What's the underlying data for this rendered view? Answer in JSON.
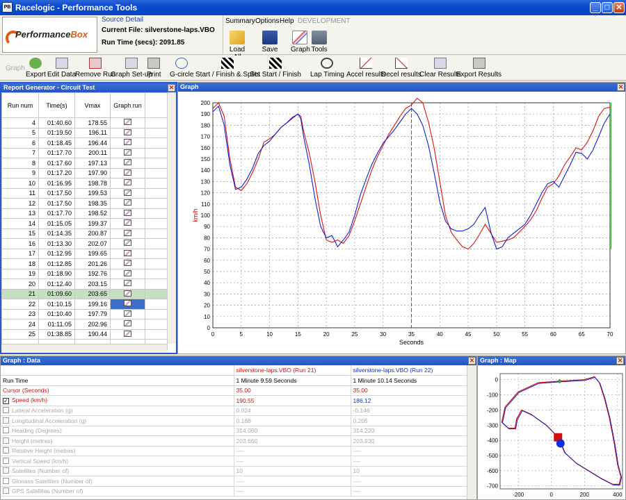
{
  "window": {
    "title": "Racelogic - Performance Tools",
    "min": "_",
    "max": "□",
    "close": "✕",
    "icon_text": "PB"
  },
  "logo": {
    "text_a": "Performance",
    "text_b": "Box"
  },
  "source": {
    "heading": "Source Detail",
    "file_label": "Current File:",
    "file": "silverstone-laps.VBO",
    "runtime_label": "Run Time (secs):",
    "runtime": "2091.85"
  },
  "menu": {
    "summary": "Summary",
    "options": "Options",
    "help": "Help",
    "development": "DEVELOPMENT"
  },
  "top_icons": {
    "load_all": "Load All",
    "save": "Save",
    "graph": "Graph",
    "tools": "Tools"
  },
  "toolbar": {
    "group_label": "Graph",
    "items": [
      "Export",
      "Edit Data",
      "Remove Run",
      "Graph Set-up",
      "Print",
      "G-circle",
      "Start / Finish & Splits",
      "Set Start / Finish",
      "Lap Timing",
      "Accel results",
      "Decel results",
      "Clear Results",
      "Export Results"
    ]
  },
  "report": {
    "title": "Report Generator - Circuit Test",
    "columns": [
      "Run num",
      "Time(s)",
      "Vmax",
      "Graph run"
    ],
    "rows": [
      [
        "4",
        "01:40.60",
        "178.55"
      ],
      [
        "5",
        "01:19.50",
        "196.11"
      ],
      [
        "6",
        "01:18.45",
        "196.44"
      ],
      [
        "7",
        "01:17.70",
        "200.11"
      ],
      [
        "8",
        "01:17.60",
        "197.13"
      ],
      [
        "9",
        "01:17.20",
        "197.90"
      ],
      [
        "10",
        "01:16.95",
        "198.78"
      ],
      [
        "11",
        "01:17.50",
        "199.53"
      ],
      [
        "12",
        "01:17.50",
        "198.35"
      ],
      [
        "13",
        "01:17.70",
        "198.52"
      ],
      [
        "14",
        "01:15.05",
        "199.37"
      ],
      [
        "15",
        "01:14.35",
        "200.87"
      ],
      [
        "16",
        "01:13.30",
        "202.07"
      ],
      [
        "17",
        "01:12.95",
        "199.65"
      ],
      [
        "18",
        "01:12.85",
        "201.26"
      ],
      [
        "19",
        "01:18.90",
        "192.76"
      ],
      [
        "20",
        "01:12.40",
        "203.15"
      ],
      [
        "21",
        "01:09.60",
        "203.65"
      ],
      [
        "22",
        "01:10.15",
        "199.16"
      ],
      [
        "23",
        "01:10.40",
        "197.79"
      ],
      [
        "24",
        "01:11.05",
        "202.96"
      ],
      [
        "25",
        "01:38.85",
        "190.44"
      ]
    ],
    "selected_run": "21"
  },
  "graph_panel": {
    "title": "Graph"
  },
  "chart_data": {
    "type": "line",
    "title": "",
    "xlabel": "Seconds",
    "ylabel": "km/h",
    "xlim": [
      0,
      70
    ],
    "ylim": [
      0,
      200
    ],
    "xticks": [
      0,
      5,
      10,
      15,
      20,
      25,
      30,
      35,
      40,
      45,
      50,
      55,
      60,
      65,
      70
    ],
    "yticks": [
      0,
      10,
      20,
      30,
      40,
      50,
      60,
      70,
      80,
      90,
      100,
      110,
      120,
      130,
      140,
      150,
      160,
      170,
      180,
      190,
      200
    ],
    "grid": true,
    "cursor_x": 35,
    "series": [
      {
        "color": "#e01010",
        "x": [
          0,
          1,
          2,
          3,
          4,
          5,
          6,
          7,
          8,
          9,
          10,
          11,
          12,
          13,
          14,
          15,
          15.5,
          16,
          17,
          18,
          19,
          20,
          21,
          22,
          23,
          24,
          25,
          26,
          27,
          28,
          29,
          30,
          31,
          32,
          33,
          34,
          35,
          36,
          37,
          38,
          39,
          40,
          41,
          42,
          43,
          44,
          45,
          46,
          47,
          48,
          49,
          50,
          51,
          52,
          53,
          54,
          55,
          56,
          57,
          58,
          59,
          60,
          61,
          62,
          63,
          64,
          65,
          66,
          67,
          68,
          69,
          70
        ],
        "y": [
          195,
          200,
          188,
          150,
          125,
          122,
          128,
          138,
          150,
          165,
          168,
          172,
          178,
          182,
          186,
          190,
          188,
          175,
          155,
          130,
          100,
          78,
          76,
          78,
          75,
          82,
          95,
          110,
          125,
          140,
          152,
          162,
          172,
          180,
          188,
          195,
          198,
          204,
          200,
          183,
          160,
          130,
          100,
          85,
          78,
          72,
          70,
          75,
          83,
          92,
          84,
          76,
          77,
          78,
          80,
          85,
          90,
          96,
          104,
          115,
          125,
          128,
          135,
          145,
          152,
          160,
          158,
          165,
          175,
          188,
          195,
          196
        ]
      },
      {
        "color": "#1020d0",
        "x": [
          0,
          1,
          2,
          3,
          4,
          5,
          6,
          7,
          8,
          9,
          10,
          11,
          12,
          13,
          14,
          15,
          15.5,
          16,
          17,
          18,
          19,
          20,
          21,
          22,
          23,
          24,
          25,
          26,
          27,
          28,
          29,
          30,
          31,
          32,
          33,
          34,
          35,
          36,
          37,
          38,
          39,
          40,
          41,
          42,
          43,
          44,
          45,
          46,
          47,
          48,
          49,
          50,
          51,
          52,
          53,
          54,
          55,
          56,
          57,
          58,
          59,
          60,
          61,
          62,
          63,
          64,
          65,
          66,
          67,
          68,
          69,
          70
        ],
        "y": [
          192,
          197,
          180,
          145,
          123,
          125,
          132,
          142,
          155,
          162,
          166,
          172,
          178,
          182,
          187,
          190,
          186,
          170,
          145,
          115,
          90,
          80,
          82,
          72,
          78,
          85,
          100,
          118,
          132,
          145,
          155,
          164,
          170,
          176,
          183,
          190,
          195,
          190,
          180,
          162,
          138,
          112,
          95,
          88,
          86,
          86,
          88,
          92,
          100,
          107,
          85,
          70,
          72,
          80,
          84,
          88,
          92,
          100,
          110,
          120,
          128,
          130,
          125,
          135,
          145,
          156,
          155,
          150,
          158,
          170,
          182,
          190
        ]
      }
    ]
  },
  "gdata": {
    "title": "Graph : Data",
    "col_a": "silverstone-laps.VBO (Run 21)",
    "col_b": "silverstone-laps.VBO (Run 22)",
    "rows": [
      {
        "label": "Run Time",
        "a": "1 Minute 9.59 Seconds",
        "b": "1 Minute 10.14 Seconds",
        "style": "normal",
        "cb": "none"
      },
      {
        "label": "Cursor (Seconds)",
        "a": "35.00",
        "b": "35.00",
        "style": "red",
        "cb": "none"
      },
      {
        "label": "Speed (km/h)",
        "a": "190.55",
        "b": "186.12",
        "style": "speed",
        "cb": "on"
      },
      {
        "label": "Lateral Acceleration (g)",
        "a": "0.024",
        "b": "-0.146",
        "style": "grey",
        "cb": "off"
      },
      {
        "label": "Longitudinal Acceleration (g)",
        "a": "0.188",
        "b": "0.205",
        "style": "grey",
        "cb": "off"
      },
      {
        "label": "Heading (Degrees)",
        "a": "314.060",
        "b": "314.220",
        "style": "grey",
        "cb": "off"
      },
      {
        "label": "Height (metres)",
        "a": "203.660",
        "b": "203.930",
        "style": "grey",
        "cb": "off"
      },
      {
        "label": "Relative Height (metres)",
        "a": "----",
        "b": "----",
        "style": "grey",
        "cb": "off"
      },
      {
        "label": "Vertical Speed (km/h)",
        "a": "----",
        "b": "----",
        "style": "grey",
        "cb": "off"
      },
      {
        "label": "Satellites (Number of)",
        "a": "10",
        "b": "10",
        "style": "grey",
        "cb": "off"
      },
      {
        "label": "Glonass Satellites (Number of)",
        "a": "----",
        "b": "----",
        "style": "grey",
        "cb": "off"
      },
      {
        "label": "GPS Satellites (Number of)",
        "a": "----",
        "b": "----",
        "style": "grey",
        "cb": "off"
      }
    ]
  },
  "gmap": {
    "title": "Graph : Map",
    "xticks": [
      "-200",
      "0",
      "200",
      "400"
    ],
    "yticks": [
      "0",
      "-100",
      "-200",
      "-300",
      "-400",
      "-500",
      "-600",
      "-700"
    ]
  }
}
